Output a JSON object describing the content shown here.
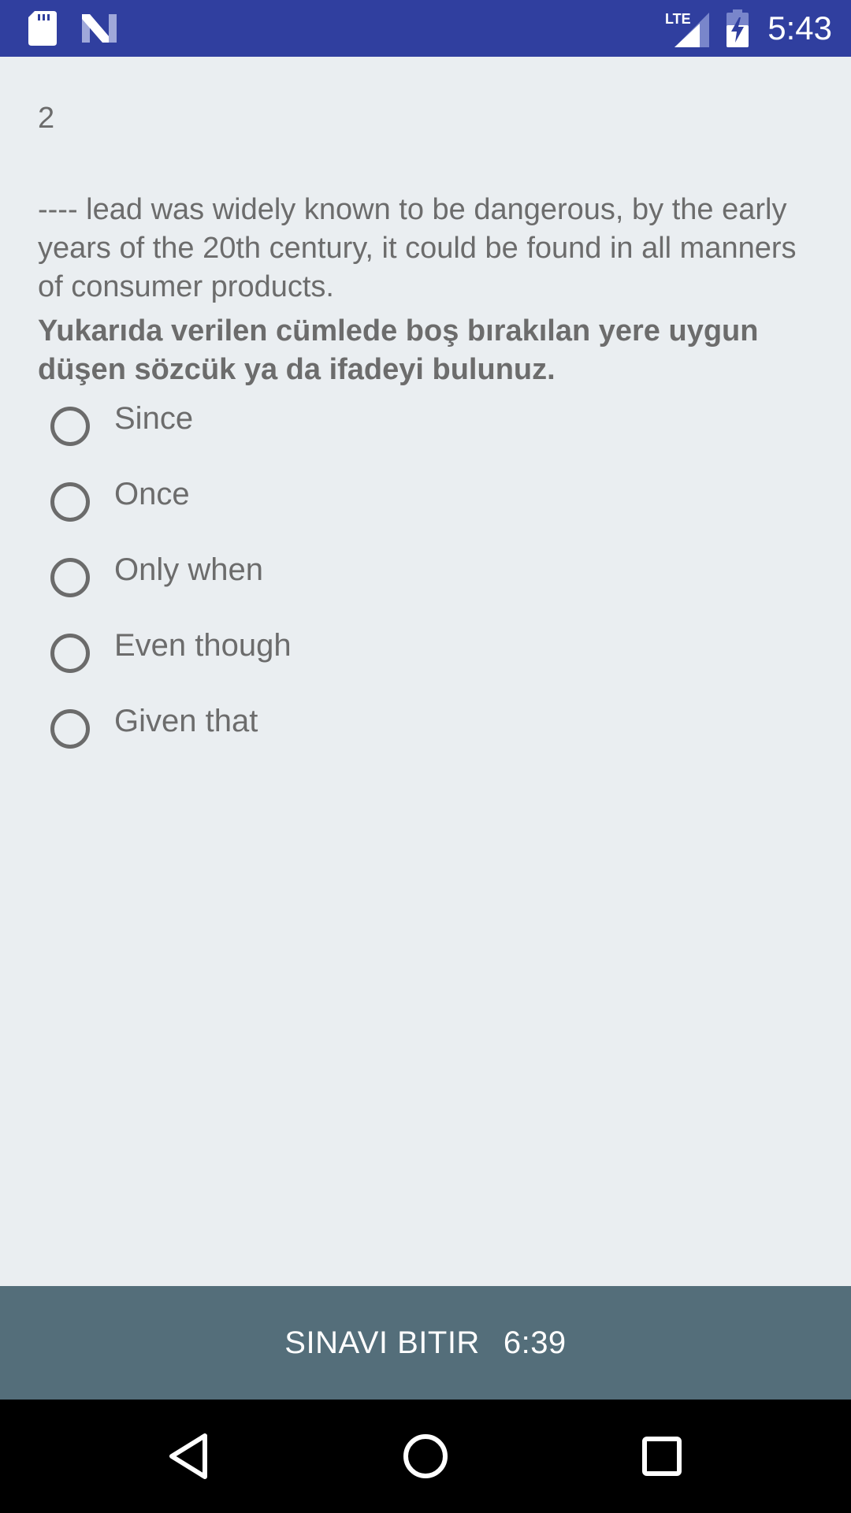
{
  "status_bar": {
    "time": "5:43",
    "network": "LTE",
    "icons": [
      "sd-card-icon",
      "n-logo-icon",
      "lte-signal-icon",
      "battery-charging-icon"
    ]
  },
  "question": {
    "number": "2",
    "text": "---- lead was widely known to be dangerous, by the early years of the 20th century, it could be found in all manners of consumer products.",
    "instruction": "Yukarıda verilen cümlede boş bırakılan yere uygun düşen sözcük ya da ifadeyi bulunuz.",
    "options": [
      {
        "label": "Since",
        "selected": false
      },
      {
        "label": "Once",
        "selected": false
      },
      {
        "label": "Only when",
        "selected": false
      },
      {
        "label": "Even though",
        "selected": false
      },
      {
        "label": "Given that",
        "selected": false
      }
    ]
  },
  "finish_bar": {
    "label": "SINAVI BITIR",
    "timer": "6:39"
  },
  "nav_bar": {
    "icons": [
      "back-icon",
      "home-icon",
      "recents-icon"
    ]
  }
}
